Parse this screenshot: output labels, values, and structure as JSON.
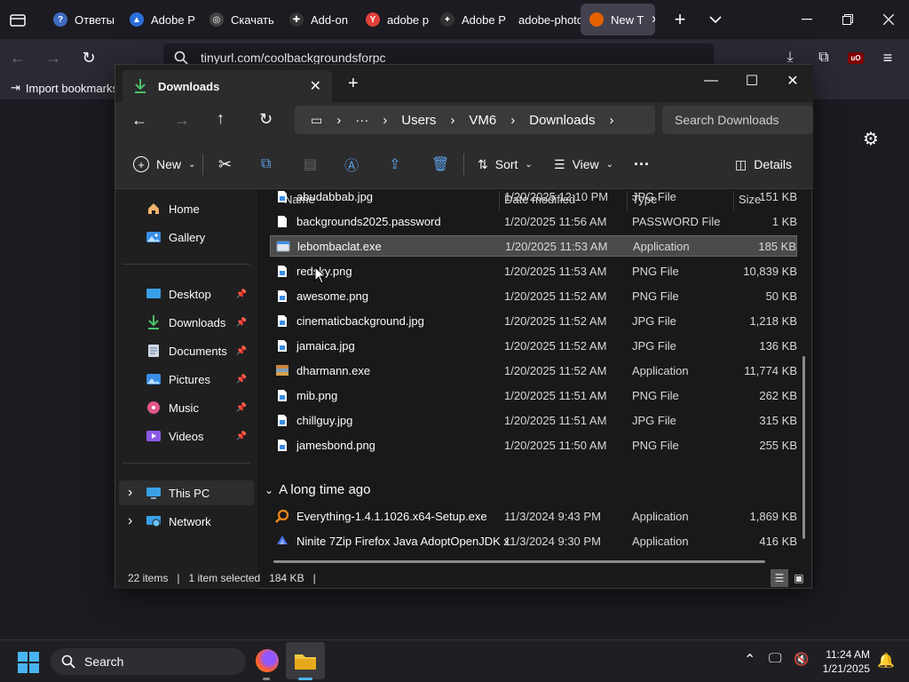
{
  "firefox": {
    "tabs": [
      {
        "label": "Ответы",
        "fav": "#3d6cc0",
        "glyph": "?"
      },
      {
        "label": "Adobe P",
        "fav": "#2a6fdb",
        "glyph": "▲"
      },
      {
        "label": "Скачать",
        "fav": "#444",
        "glyph": "◎"
      },
      {
        "label": "Add-on",
        "fav": "#333",
        "glyph": "✚"
      },
      {
        "label": "adobe p",
        "fav": "#e0413a",
        "glyph": "Y"
      },
      {
        "label": "Adobe P",
        "fav": "#333",
        "glyph": "✦"
      },
      {
        "label": "adobe-photo",
        "fav": "",
        "glyph": ""
      },
      {
        "label": "New T",
        "fav": "#e66000",
        "glyph": ""
      }
    ],
    "url": "tinyurl.com/coolbackgroundsforpc",
    "bookmark_import": "Import bookmarks",
    "ublock_label": "uO"
  },
  "explorer": {
    "tab_title": "Downloads",
    "breadcrumb": [
      "Users",
      "VM6",
      "Downloads"
    ],
    "search_placeholder": "Search Downloads",
    "commands": {
      "new": "New",
      "sort": "Sort",
      "view": "View",
      "details": "Details"
    },
    "nav": [
      {
        "label": "Home",
        "icon": "home-icon"
      },
      {
        "label": "Gallery",
        "icon": "gallery-icon"
      },
      {
        "label": "Desktop",
        "icon": "desktop-icon",
        "pinned": true
      },
      {
        "label": "Downloads",
        "icon": "downloads-icon",
        "pinned": true
      },
      {
        "label": "Documents",
        "icon": "documents-icon",
        "pinned": true
      },
      {
        "label": "Pictures",
        "icon": "pictures-icon",
        "pinned": true
      },
      {
        "label": "Music",
        "icon": "music-icon",
        "pinned": true
      },
      {
        "label": "Videos",
        "icon": "videos-icon",
        "pinned": true
      },
      {
        "label": "This PC",
        "icon": "pc-icon"
      },
      {
        "label": "Network",
        "icon": "network-icon"
      }
    ],
    "columns": {
      "name": "Name",
      "date": "Date modified",
      "type": "Type",
      "size": "Size"
    },
    "files": [
      {
        "name": "abudabbab.jpg",
        "date": "1/20/2025 12:10 PM",
        "type": "JPG File",
        "size": "151 KB",
        "icon": "image-file-icon"
      },
      {
        "name": "backgrounds2025.password",
        "date": "1/20/2025 11:56 AM",
        "type": "PASSWORD File",
        "size": "1 KB",
        "icon": "blank-file-icon"
      },
      {
        "name": "lebombaclat.exe",
        "date": "1/20/2025 11:53 AM",
        "type": "Application",
        "size": "185 KB",
        "icon": "exe-icon",
        "selected": true
      },
      {
        "name": "redsky.png",
        "date": "1/20/2025 11:53 AM",
        "type": "PNG File",
        "size": "10,839 KB",
        "icon": "image-file-icon"
      },
      {
        "name": "awesome.png",
        "date": "1/20/2025 11:52 AM",
        "type": "PNG File",
        "size": "50 KB",
        "icon": "image-file-icon"
      },
      {
        "name": "cinematicbackground.jpg",
        "date": "1/20/2025 11:52 AM",
        "type": "JPG File",
        "size": "1,218 KB",
        "icon": "image-file-icon"
      },
      {
        "name": "jamaica.jpg",
        "date": "1/20/2025 11:52 AM",
        "type": "JPG File",
        "size": "136 KB",
        "icon": "image-file-icon"
      },
      {
        "name": "dharmann.exe",
        "date": "1/20/2025 11:52 AM",
        "type": "Application",
        "size": "11,774 KB",
        "icon": "app-icon"
      },
      {
        "name": "mib.png",
        "date": "1/20/2025 11:51 AM",
        "type": "PNG File",
        "size": "262 KB",
        "icon": "image-file-icon"
      },
      {
        "name": "chillguy.jpg",
        "date": "1/20/2025 11:51 AM",
        "type": "JPG File",
        "size": "315 KB",
        "icon": "image-file-icon"
      },
      {
        "name": "jamesbond.png",
        "date": "1/20/2025 11:50 AM",
        "type": "PNG File",
        "size": "255 KB",
        "icon": "image-file-icon"
      }
    ],
    "group_label": "A long time ago",
    "old_files": [
      {
        "name": "Everything-1.4.1.1026.x64-Setup.exe",
        "date": "11/3/2024 9:43 PM",
        "type": "Application",
        "size": "1,869 KB",
        "icon": "everything-icon"
      },
      {
        "name": "Ninite 7Zip Firefox Java AdoptOpenJDK x...",
        "date": "11/3/2024 9:30 PM",
        "type": "Application",
        "size": "416 KB",
        "icon": "ninite-icon"
      }
    ],
    "status": {
      "items": "22 items",
      "selected": "1 item selected",
      "size": "184 KB"
    }
  },
  "taskbar": {
    "search": "Search",
    "time": "11:24 AM",
    "date": "1/21/2025"
  }
}
